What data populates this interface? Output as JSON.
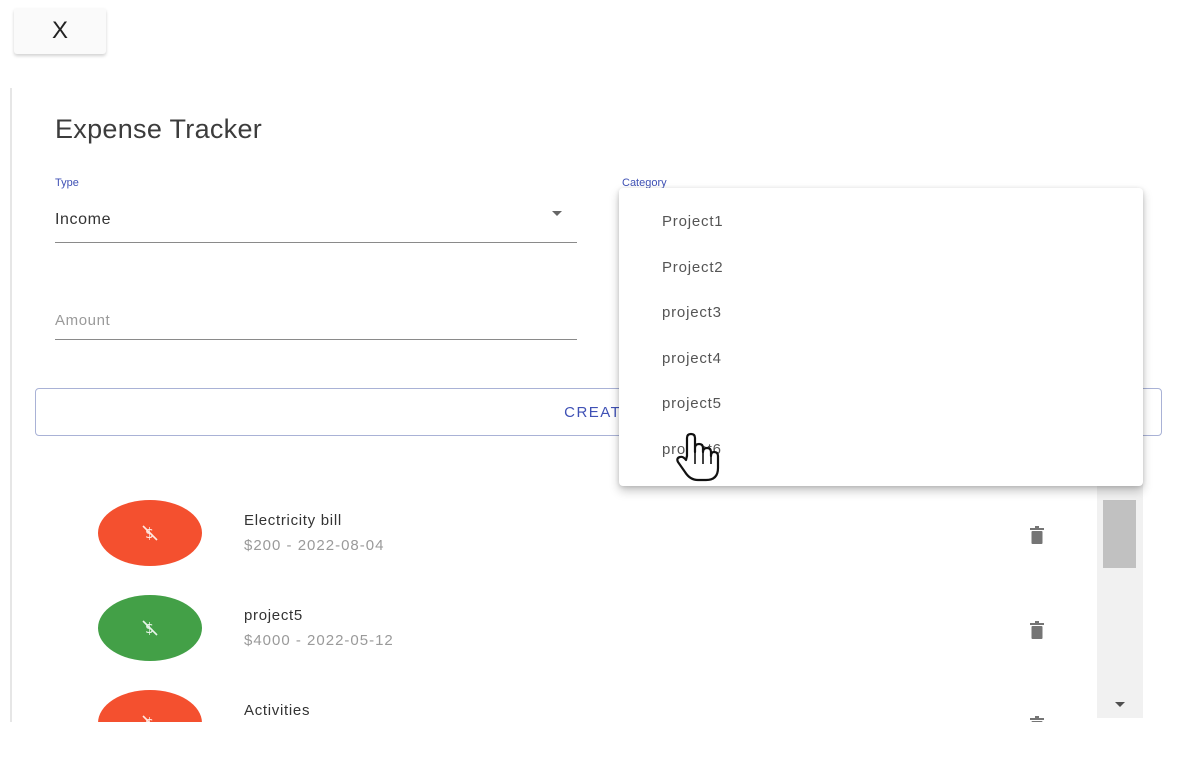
{
  "header": {
    "close_label": "X"
  },
  "form": {
    "title": "Expense Tracker",
    "type_label": "Type",
    "type_value": "Income",
    "category_label": "Category",
    "amount_placeholder": "Amount",
    "create_label": "CREATE"
  },
  "category_options": [
    "Project1",
    "Project2",
    "project3",
    "project4",
    "project5",
    "project6"
  ],
  "transactions": [
    {
      "title": "Electricity bill",
      "subtitle": "$200 - 2022-08-04",
      "type": "expense",
      "color": "#f4502f"
    },
    {
      "title": "project5",
      "subtitle": "$4000 - 2022-05-12",
      "type": "income",
      "color": "#43a047"
    },
    {
      "title": "Activities",
      "subtitle": "",
      "type": "expense",
      "color": "#f4502f"
    }
  ],
  "icons": {
    "avatar": "money-off-icon",
    "delete": "trash-icon",
    "cursor": "hand-pointer-icon"
  },
  "colors": {
    "accent": "#3f51b5",
    "expense": "#f4502f",
    "income": "#43a047"
  }
}
